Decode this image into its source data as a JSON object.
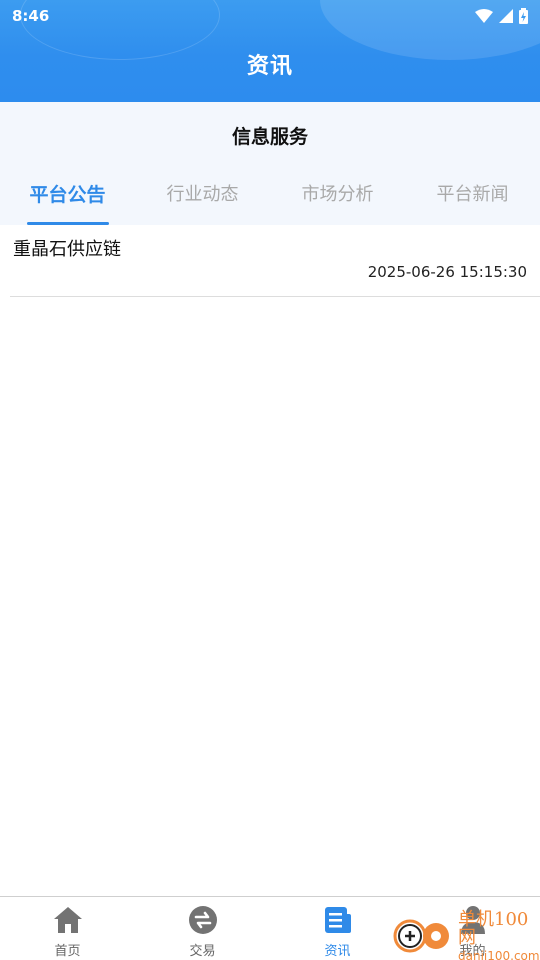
{
  "status_bar": {
    "time": "8:46"
  },
  "header": {
    "title": "资讯"
  },
  "section": {
    "title": "信息服务"
  },
  "tabs": [
    {
      "label": "平台公告",
      "active": true
    },
    {
      "label": "行业动态",
      "active": false
    },
    {
      "label": "市场分析",
      "active": false
    },
    {
      "label": "平台新闻",
      "active": false
    }
  ],
  "list": [
    {
      "title": "重晶石供应链",
      "date": "2025-06-26 15:15:30"
    }
  ],
  "bottom_nav": [
    {
      "label": "首页",
      "icon": "home-icon",
      "active": false
    },
    {
      "label": "交易",
      "icon": "exchange-icon",
      "active": false
    },
    {
      "label": "资讯",
      "icon": "news-icon",
      "active": true
    },
    {
      "label": "我的",
      "icon": "user-icon",
      "active": false
    }
  ],
  "watermark": {
    "main": "单机100网",
    "sub": "danji100.com"
  },
  "colors": {
    "accent": "#2f8ae8",
    "header": "#2d8cee",
    "section_bg": "#f3f7fd",
    "inactive_tab": "#a9a9a9"
  }
}
